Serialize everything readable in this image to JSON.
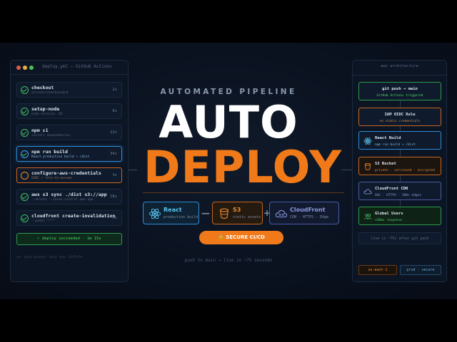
{
  "left_panel": {
    "title": "deploy.yml — GitHub Actions",
    "steps": [
      {
        "name": "checkout",
        "sub": "actions/checkout@v4",
        "time": "2s"
      },
      {
        "name": "setup-node",
        "sub": "node-version: 20",
        "time": "8s"
      },
      {
        "name": "npm ci",
        "sub": "install dependencies",
        "time": "22s"
      },
      {
        "name": "npm run build",
        "sub": "React production build → /dist",
        "time": "34s"
      },
      {
        "name": "configure-aws-credentials",
        "sub": "OIDC / role-to-assume",
        "time": "3s"
      },
      {
        "name": "aws s3 sync ./dist s3://app",
        "sub": "--delete --cache-control max-age",
        "time": "18s"
      },
      {
        "name": "cloudfront create-invalidation",
        "sub": "--paths \"/*\"",
        "time": "6s"
      }
    ],
    "success": "✓ deploy succeeded · 1m 15s",
    "footer": "on: push branch: main sha: a1f9c3e"
  },
  "center": {
    "eyebrow": "AUTOMATED PIPELINE",
    "title_line1": "AUTO",
    "title_line2": "DEPLOY",
    "services": [
      {
        "name": "React",
        "desc": "production build",
        "icon": "react-icon"
      },
      {
        "name": "S3",
        "desc": "static assets",
        "icon": "bucket-icon"
      },
      {
        "name": "CloudFront",
        "desc": "CDN · HTTPS · Edge",
        "icon": "cloud-icon"
      }
    ],
    "joiners": [
      "—",
      "+"
    ],
    "badge": "🔒 SECURE CI/CD",
    "tagline": "push to main → live in ~75 seconds"
  },
  "right_panel": {
    "title": "aws architecture",
    "nodes": [
      {
        "title": "git push → main",
        "sub": "GitHub Actions triggered"
      },
      {
        "title": "IAM OIDC Role",
        "sub": "no static credentials"
      },
      {
        "title": "React Build",
        "sub": "npm run build → /dist",
        "icon": "react-icon"
      },
      {
        "title": "S3 Bucket",
        "sub": "private · versioned · encrypted",
        "icon": "bucket-icon"
      },
      {
        "title": "CloudFront CDN",
        "sub": "OAC · HTTPS · 300+ edges",
        "icon": "cloud-icon"
      },
      {
        "title": "Global Users",
        "sub": "<50ms response",
        "icon": "users-icon"
      }
    ],
    "live_note": "live in ~75s after git push",
    "tags": [
      "us-east-1",
      "prod · secure"
    ]
  },
  "colors": {
    "accent_orange": "#f07a1a",
    "accent_blue": "#2d8cd6",
    "accent_green": "#3fbf5f",
    "background": "#0a1220"
  }
}
